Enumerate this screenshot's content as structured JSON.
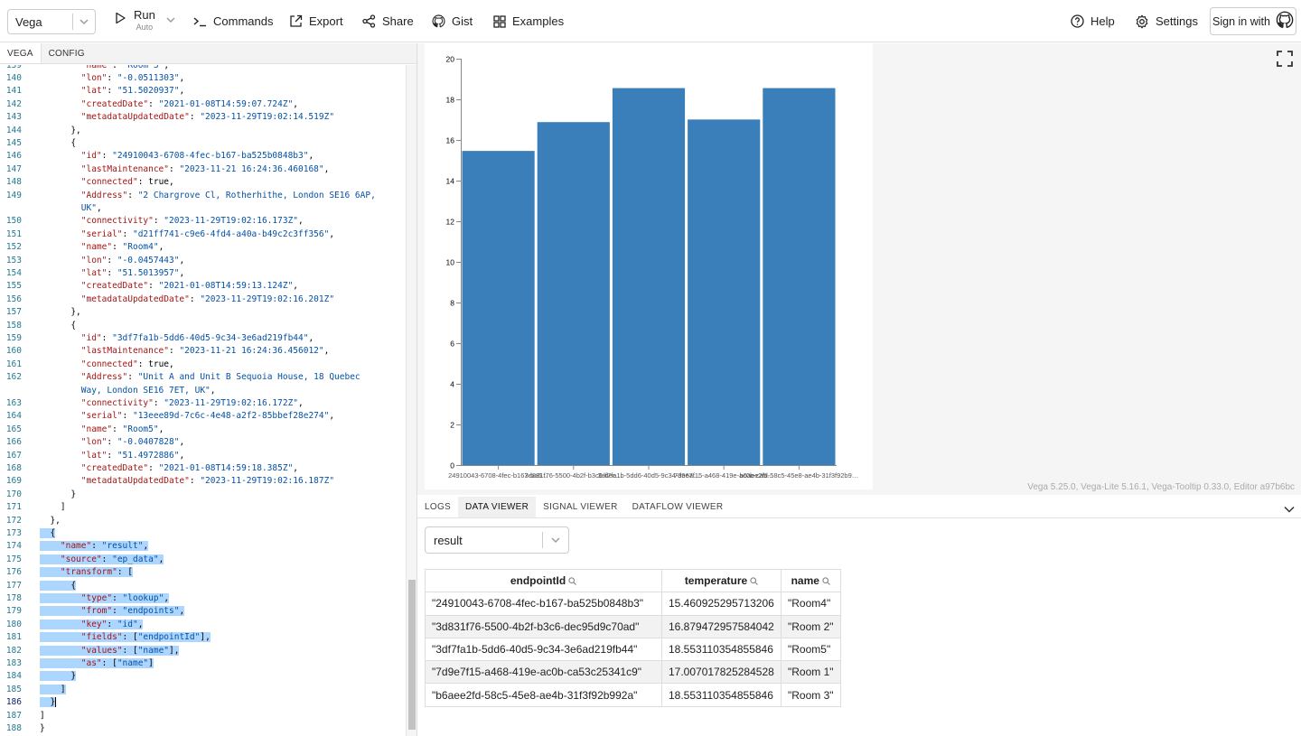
{
  "header": {
    "mode": "Vega",
    "run_label": "Run",
    "run_sub": "Auto",
    "commands_label": "Commands",
    "export_label": "Export",
    "share_label": "Share",
    "gist_label": "Gist",
    "examples_label": "Examples",
    "help_label": "Help",
    "settings_label": "Settings",
    "signin_label": "Sign in with"
  },
  "editor": {
    "tabs": [
      "VEGA",
      "CONFIG"
    ],
    "lines": [
      {
        "n": "139",
        "t": [
          [
            "",
            "        "
          ],
          [
            "k",
            "\"name\""
          ],
          [
            "",
            ": "
          ],
          [
            "s",
            "\"Room 3\""
          ],
          [
            "",
            ","
          ]
        ]
      },
      {
        "n": "140",
        "t": [
          [
            "",
            "        "
          ],
          [
            "k",
            "\"lon\""
          ],
          [
            "",
            ": "
          ],
          [
            "s",
            "\"-0.0511303\""
          ],
          [
            "",
            ","
          ]
        ]
      },
      {
        "n": "141",
        "t": [
          [
            "",
            "        "
          ],
          [
            "k",
            "\"lat\""
          ],
          [
            "",
            ": "
          ],
          [
            "s",
            "\"51.5020937\""
          ],
          [
            "",
            ","
          ]
        ]
      },
      {
        "n": "142",
        "t": [
          [
            "",
            "        "
          ],
          [
            "k",
            "\"createdDate\""
          ],
          [
            "",
            ": "
          ],
          [
            "s",
            "\"2021-01-08T14:59:07.724Z\""
          ],
          [
            "",
            ","
          ]
        ]
      },
      {
        "n": "143",
        "t": [
          [
            "",
            "        "
          ],
          [
            "k",
            "\"metadataUpdatedDate\""
          ],
          [
            "",
            ": "
          ],
          [
            "s",
            "\"2023-11-29T19:02:14.519Z\""
          ]
        ]
      },
      {
        "n": "144",
        "t": [
          [
            "",
            "      },"
          ]
        ]
      },
      {
        "n": "145",
        "t": [
          [
            "",
            "      {"
          ]
        ]
      },
      {
        "n": "146",
        "t": [
          [
            "",
            "        "
          ],
          [
            "k",
            "\"id\""
          ],
          [
            "",
            ": "
          ],
          [
            "s",
            "\"24910043-6708-4fec-b167-ba525b0848b3\""
          ],
          [
            "",
            ","
          ]
        ]
      },
      {
        "n": "147",
        "t": [
          [
            "",
            "        "
          ],
          [
            "k",
            "\"lastMaintenance\""
          ],
          [
            "",
            ": "
          ],
          [
            "s",
            "\"2023-11-21 16:24:36.460168\""
          ],
          [
            "",
            ","
          ]
        ]
      },
      {
        "n": "148",
        "t": [
          [
            "",
            "        "
          ],
          [
            "k",
            "\"connected\""
          ],
          [
            "",
            ": true,"
          ]
        ]
      },
      {
        "n": "149",
        "t": [
          [
            "",
            "        "
          ],
          [
            "k",
            "\"Address\""
          ],
          [
            "",
            ": "
          ],
          [
            "s",
            "\"2 Chargrove Cl, Rotherhithe, London SE16 6AP,"
          ]
        ]
      },
      {
        "n": "",
        "t": [
          [
            "",
            "        "
          ],
          [
            "s",
            "UK\""
          ],
          [
            "",
            ","
          ]
        ]
      },
      {
        "n": "150",
        "t": [
          [
            "",
            "        "
          ],
          [
            "k",
            "\"connectivity\""
          ],
          [
            "",
            ": "
          ],
          [
            "s",
            "\"2023-11-29T19:02:16.173Z\""
          ],
          [
            "",
            ","
          ]
        ]
      },
      {
        "n": "151",
        "t": [
          [
            "",
            "        "
          ],
          [
            "k",
            "\"serial\""
          ],
          [
            "",
            ": "
          ],
          [
            "s",
            "\"d21ff741-c9e6-4fd4-a40a-b49c2c3ff356\""
          ],
          [
            "",
            ","
          ]
        ]
      },
      {
        "n": "152",
        "t": [
          [
            "",
            "        "
          ],
          [
            "k",
            "\"name\""
          ],
          [
            "",
            ": "
          ],
          [
            "s",
            "\"Room4\""
          ],
          [
            "",
            ","
          ]
        ]
      },
      {
        "n": "153",
        "t": [
          [
            "",
            "        "
          ],
          [
            "k",
            "\"lon\""
          ],
          [
            "",
            ": "
          ],
          [
            "s",
            "\"-0.0457443\""
          ],
          [
            "",
            ","
          ]
        ]
      },
      {
        "n": "154",
        "t": [
          [
            "",
            "        "
          ],
          [
            "k",
            "\"lat\""
          ],
          [
            "",
            ": "
          ],
          [
            "s",
            "\"51.5013957\""
          ],
          [
            "",
            ","
          ]
        ]
      },
      {
        "n": "155",
        "t": [
          [
            "",
            "        "
          ],
          [
            "k",
            "\"createdDate\""
          ],
          [
            "",
            ": "
          ],
          [
            "s",
            "\"2021-01-08T14:59:13.124Z\""
          ],
          [
            "",
            ","
          ]
        ]
      },
      {
        "n": "156",
        "t": [
          [
            "",
            "        "
          ],
          [
            "k",
            "\"metadataUpdatedDate\""
          ],
          [
            "",
            ": "
          ],
          [
            "s",
            "\"2023-11-29T19:02:16.201Z\""
          ]
        ]
      },
      {
        "n": "157",
        "t": [
          [
            "",
            "      },"
          ]
        ]
      },
      {
        "n": "158",
        "t": [
          [
            "",
            "      {"
          ]
        ]
      },
      {
        "n": "159",
        "t": [
          [
            "",
            "        "
          ],
          [
            "k",
            "\"id\""
          ],
          [
            "",
            ": "
          ],
          [
            "s",
            "\"3df7fa1b-5dd6-40d5-9c34-3e6ad219fb44\""
          ],
          [
            "",
            ","
          ]
        ]
      },
      {
        "n": "160",
        "t": [
          [
            "",
            "        "
          ],
          [
            "k",
            "\"lastMaintenance\""
          ],
          [
            "",
            ": "
          ],
          [
            "s",
            "\"2023-11-21 16:24:36.456012\""
          ],
          [
            "",
            ","
          ]
        ]
      },
      {
        "n": "161",
        "t": [
          [
            "",
            "        "
          ],
          [
            "k",
            "\"connected\""
          ],
          [
            "",
            ": true,"
          ]
        ]
      },
      {
        "n": "162",
        "t": [
          [
            "",
            "        "
          ],
          [
            "k",
            "\"Address\""
          ],
          [
            "",
            ": "
          ],
          [
            "s",
            "\"Unit A and Unit B Sequoia House, 18 Quebec"
          ]
        ]
      },
      {
        "n": "",
        "t": [
          [
            "",
            "        "
          ],
          [
            "s",
            "Way, London SE16 7ET, UK\""
          ],
          [
            "",
            ","
          ]
        ]
      },
      {
        "n": "163",
        "t": [
          [
            "",
            "        "
          ],
          [
            "k",
            "\"connectivity\""
          ],
          [
            "",
            ": "
          ],
          [
            "s",
            "\"2023-11-29T19:02:16.172Z\""
          ],
          [
            "",
            ","
          ]
        ]
      },
      {
        "n": "164",
        "t": [
          [
            "",
            "        "
          ],
          [
            "k",
            "\"serial\""
          ],
          [
            "",
            ": "
          ],
          [
            "s",
            "\"13eee89d-7c6c-4e48-a2f2-85bbef28e274\""
          ],
          [
            "",
            ","
          ]
        ]
      },
      {
        "n": "165",
        "t": [
          [
            "",
            "        "
          ],
          [
            "k",
            "\"name\""
          ],
          [
            "",
            ": "
          ],
          [
            "s",
            "\"Room5\""
          ],
          [
            "",
            ","
          ]
        ]
      },
      {
        "n": "166",
        "t": [
          [
            "",
            "        "
          ],
          [
            "k",
            "\"lon\""
          ],
          [
            "",
            ": "
          ],
          [
            "s",
            "\"-0.0407828\""
          ],
          [
            "",
            ","
          ]
        ]
      },
      {
        "n": "167",
        "t": [
          [
            "",
            "        "
          ],
          [
            "k",
            "\"lat\""
          ],
          [
            "",
            ": "
          ],
          [
            "s",
            "\"51.4972886\""
          ],
          [
            "",
            ","
          ]
        ]
      },
      {
        "n": "168",
        "t": [
          [
            "",
            "        "
          ],
          [
            "k",
            "\"createdDate\""
          ],
          [
            "",
            ": "
          ],
          [
            "s",
            "\"2021-01-08T14:59:18.385Z\""
          ],
          [
            "",
            ","
          ]
        ]
      },
      {
        "n": "169",
        "t": [
          [
            "",
            "        "
          ],
          [
            "k",
            "\"metadataUpdatedDate\""
          ],
          [
            "",
            ": "
          ],
          [
            "s",
            "\"2023-11-29T19:02:16.187Z\""
          ]
        ]
      },
      {
        "n": "170",
        "t": [
          [
            "",
            "      }"
          ]
        ]
      },
      {
        "n": "171",
        "t": [
          [
            "",
            "    ]"
          ]
        ]
      },
      {
        "n": "172",
        "t": [
          [
            "",
            "  },"
          ]
        ]
      },
      {
        "n": "173",
        "t": [
          [
            "sel",
            "  {"
          ]
        ]
      },
      {
        "n": "174",
        "t": [
          [
            "sel",
            "    "
          ],
          [
            "sel k",
            "\"name\""
          ],
          [
            "sel",
            ": "
          ],
          [
            "sel s",
            "\"result\""
          ],
          [
            "sel",
            ","
          ]
        ]
      },
      {
        "n": "175",
        "t": [
          [
            "sel",
            "    "
          ],
          [
            "sel k",
            "\"source\""
          ],
          [
            "sel",
            ": "
          ],
          [
            "sel s",
            "\"ep_data\""
          ],
          [
            "sel",
            ","
          ]
        ]
      },
      {
        "n": "176",
        "t": [
          [
            "sel",
            "    "
          ],
          [
            "sel k",
            "\"transform\""
          ],
          [
            "sel",
            ": ["
          ]
        ]
      },
      {
        "n": "177",
        "t": [
          [
            "sel",
            "      {"
          ]
        ]
      },
      {
        "n": "178",
        "t": [
          [
            "sel",
            "        "
          ],
          [
            "sel k",
            "\"type\""
          ],
          [
            "sel",
            ": "
          ],
          [
            "sel s",
            "\"lookup\""
          ],
          [
            "sel",
            ","
          ]
        ]
      },
      {
        "n": "179",
        "t": [
          [
            "sel",
            "        "
          ],
          [
            "sel k",
            "\"from\""
          ],
          [
            "sel",
            ": "
          ],
          [
            "sel s",
            "\"endpoints\""
          ],
          [
            "sel",
            ","
          ]
        ]
      },
      {
        "n": "180",
        "t": [
          [
            "sel",
            "        "
          ],
          [
            "sel k",
            "\"key\""
          ],
          [
            "sel",
            ": "
          ],
          [
            "sel s",
            "\"id\""
          ],
          [
            "sel",
            ","
          ]
        ]
      },
      {
        "n": "181",
        "t": [
          [
            "sel",
            "        "
          ],
          [
            "sel k",
            "\"fields\""
          ],
          [
            "sel",
            ": ["
          ],
          [
            "sel s",
            "\"endpointId\""
          ],
          [
            "sel",
            "],"
          ]
        ]
      },
      {
        "n": "182",
        "t": [
          [
            "sel",
            "        "
          ],
          [
            "sel k",
            "\"values\""
          ],
          [
            "sel",
            ": ["
          ],
          [
            "sel s",
            "\"name\""
          ],
          [
            "sel",
            "],"
          ]
        ]
      },
      {
        "n": "183",
        "t": [
          [
            "sel",
            "        "
          ],
          [
            "sel k",
            "\"as\""
          ],
          [
            "sel",
            ": ["
          ],
          [
            "sel s",
            "\"name\""
          ],
          [
            "sel",
            "]"
          ]
        ]
      },
      {
        "n": "184",
        "t": [
          [
            "sel",
            "      }"
          ]
        ]
      },
      {
        "n": "185",
        "t": [
          [
            "sel",
            "    ]"
          ]
        ]
      },
      {
        "n": "186",
        "t": [
          [
            "sel",
            "  }"
          ],
          [
            "cur",
            ""
          ]
        ]
      },
      {
        "n": "187",
        "t": [
          [
            "",
            "]"
          ]
        ]
      },
      {
        "n": "188",
        "t": [
          [
            "",
            "}"
          ]
        ]
      }
    ]
  },
  "chart_data": {
    "type": "bar",
    "categories": [
      "24910043-6708-4fec-b167-ba525b0848b3",
      "3d831f76-5500-4b2f-b3c6-dec95d9c70ad",
      "3df7fa1b-5dd6-40d5-9c34-3e6ad219fb44",
      "7d9e7f15-a468-419e-ac0b-ca53c25341c9",
      "b6aee2fd-58c5-45e8-ae4b-31f3f92b992a"
    ],
    "category_labels": [
      "24910043-6708-4fec-b167-ba5…",
      "3d831f76-5500-4b2f-b3c6-dec…",
      "3df7fa1b-5dd6-40d5-9c34-3e6a…",
      "7d9e7f15-a468-419e-ac0b-ca5…",
      "b6aee2fd-58c5-45e8-ae4b-31f3f92b9…"
    ],
    "values": [
      15.460925295713206,
      16.879472957584042,
      18.553110354855846,
      17.007017825284528,
      18.553110354855846
    ],
    "ylim": [
      0,
      20
    ],
    "yticks": [
      0,
      2,
      4,
      6,
      8,
      10,
      12,
      14,
      16,
      18,
      20
    ],
    "bar_color": "#3a7fba"
  },
  "footer": {
    "versions": "Vega 5.25.0, Vega-Lite 5.16.1, Vega-Tooltip 0.33.0, Editor a97b6bc"
  },
  "debug": {
    "tabs": [
      "LOGS",
      "DATA VIEWER",
      "SIGNAL VIEWER",
      "DATAFLOW VIEWER"
    ],
    "active_tab": "DATA VIEWER",
    "dataset": "result",
    "columns": [
      "endpointId",
      "temperature",
      "name"
    ],
    "rows": [
      [
        "\"24910043-6708-4fec-b167-ba525b0848b3\"",
        "15.460925295713206",
        "\"Room4\""
      ],
      [
        "\"3d831f76-5500-4b2f-b3c6-dec95d9c70ad\"",
        "16.879472957584042",
        "\"Room 2\""
      ],
      [
        "\"3df7fa1b-5dd6-40d5-9c34-3e6ad219fb44\"",
        "18.553110354855846",
        "\"Room5\""
      ],
      [
        "\"7d9e7f15-a468-419e-ac0b-ca53c25341c9\"",
        "17.007017825284528",
        "\"Room 1\""
      ],
      [
        "\"b6aee2fd-58c5-45e8-ae4b-31f3f92b992a\"",
        "18.553110354855846",
        "\"Room 3\""
      ]
    ]
  }
}
